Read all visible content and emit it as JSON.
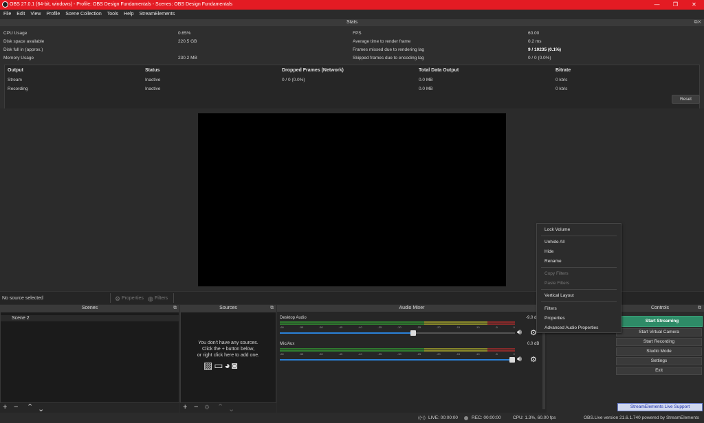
{
  "window": {
    "title": "OBS 27.0.1 (64-bit, windows) - Profile: OBS Design Fundamentals - Scenes: OBS Design Fundamentals",
    "controls": [
      "—",
      "❐",
      "✕"
    ]
  },
  "menu": [
    "File",
    "Edit",
    "View",
    "Profile",
    "Scene Collection",
    "Tools",
    "Help",
    "StreamElements"
  ],
  "stats": {
    "title": "Stats",
    "left": [
      {
        "label": "CPU Usage",
        "value": "0.65%"
      },
      {
        "label": "Disk space available",
        "value": "220.5 GB"
      },
      {
        "label": "Disk full in (approx.)",
        "value": ""
      },
      {
        "label": "Memory Usage",
        "value": "230.2 MB"
      }
    ],
    "right": [
      {
        "label": "FPS",
        "value": "60.00"
      },
      {
        "label": "Average time to render frame",
        "value": "0.2 ms"
      },
      {
        "label": "Frames missed due to rendering lag",
        "value": "9 / 10235 (0.1%)"
      },
      {
        "label": "Skipped frames due to encoding lag",
        "value": "0 / 0 (0.0%)"
      }
    ],
    "table": {
      "headers": [
        "Output",
        "Status",
        "Dropped Frames (Network)",
        "Total Data Output",
        "Bitrate"
      ],
      "rows": [
        [
          "Stream",
          "Inactive",
          "0 / 0 (0.0%)",
          "0.0 MB",
          "0 kb/s"
        ],
        [
          "Recording",
          "Inactive",
          "",
          "0.0 MB",
          "0 kb/s"
        ]
      ]
    },
    "reset_label": "Reset"
  },
  "context_bar": {
    "no_source": "No source selected",
    "properties": "Properties",
    "filters": "Filters"
  },
  "scenes": {
    "title": "Scenes",
    "items": [
      "Scene 2"
    ]
  },
  "sources": {
    "title": "Sources",
    "empty_line1": "You don't have any sources.",
    "empty_line2": "Click the + button below,",
    "empty_line3": "or right click here to add one."
  },
  "mixer": {
    "title": "Audio Mixer",
    "channels": [
      {
        "name": "Desktop Audio",
        "db": "-9.0 dB",
        "volume": 0.57
      },
      {
        "name": "Mic/Aux",
        "db": "0.0 dB",
        "volume": 1.0
      }
    ],
    "scale": [
      "-60",
      "-55",
      "-50",
      "-45",
      "-40",
      "-35",
      "-30",
      "-25",
      "-20",
      "-15",
      "-10",
      "-5",
      "0"
    ]
  },
  "context_menu": {
    "items": [
      "Lock Volume",
      "Unhide All",
      "Hide",
      "Rename",
      "Copy Filters",
      "Paste Filters",
      "Vertical Layout",
      "Filters",
      "Properties",
      "Advanced Audio Properties"
    ]
  },
  "controls": {
    "title": "Controls",
    "buttons": [
      "Start Streaming",
      "Start Virtual Camera",
      "Start Recording",
      "Studio Mode",
      "Settings",
      "Exit"
    ],
    "support_button": "StreamElements Live Support",
    "accent": "#2e8b67"
  },
  "statusbar": {
    "live": "LIVE: 00:00:00",
    "rec": "REC: 00:00:00",
    "cpu": "CPU: 1.3%, 60.00 fps",
    "version": "OBS.Live version 21.6.1.740 powered by StreamElements"
  }
}
